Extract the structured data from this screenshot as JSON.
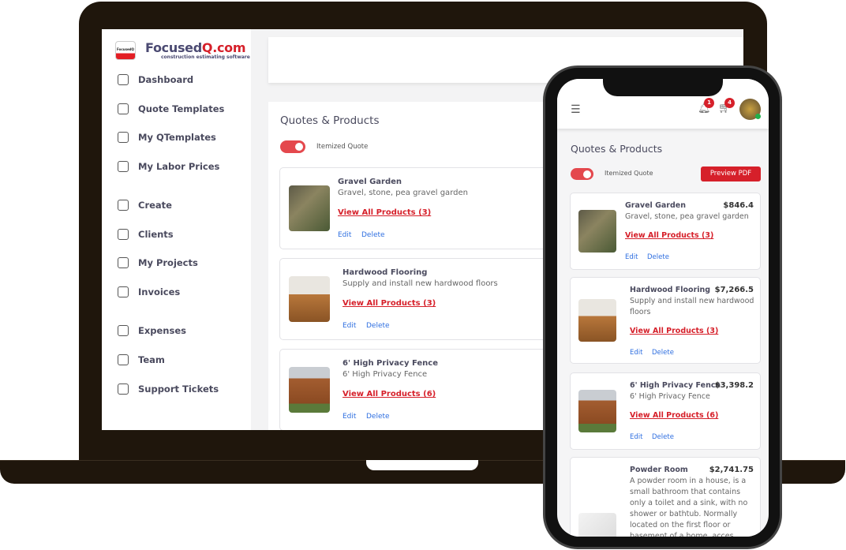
{
  "brand": {
    "name_main": "Focused",
    "name_accent": "Q.com",
    "tagline": "construction estimating software",
    "logo_text": "FocusedQ"
  },
  "sidebar": {
    "items": [
      {
        "label": "Dashboard",
        "icon": "home-icon"
      },
      {
        "label": "Quote Templates",
        "icon": "shopping-bag-icon"
      },
      {
        "label": "My QTemplates",
        "icon": "download-icon"
      },
      {
        "label": "My Labor Prices",
        "icon": "box-icon"
      },
      {
        "label": "Create",
        "icon": "plus-circle-icon"
      },
      {
        "label": "Clients",
        "icon": "users-icon"
      },
      {
        "label": "My Projects",
        "icon": "cart-icon"
      },
      {
        "label": "Invoices",
        "icon": "book-icon"
      },
      {
        "label": "Expenses",
        "icon": "dollar-icon"
      },
      {
        "label": "Team",
        "icon": "team-icon"
      },
      {
        "label": "Support Tickets",
        "icon": "alert-circle-icon"
      }
    ]
  },
  "main": {
    "title": "Quotes & Products",
    "toggle_label": "Itemized Quote",
    "toggle_on": true,
    "preview_label": "Preview PDF",
    "edit": "Edit",
    "delete": "Delete"
  },
  "header": {
    "notifications": "1",
    "cart": "4"
  },
  "products": [
    {
      "name": "Gravel Garden",
      "desc": "Gravel, stone, pea gravel garden",
      "link": "View All Products (3)",
      "price": "$846.4"
    },
    {
      "name": "Hardwood Flooring",
      "desc": "Supply and install new hardwood floors",
      "link": "View All Products (3)",
      "price": "$7,266.5"
    },
    {
      "name": "6' High Privacy Fence",
      "desc": "6' High Privacy Fence",
      "link": "View All Products (6)",
      "price": "$3,398.2"
    },
    {
      "name": "Powder Room",
      "desc": "A powder room in a house, is a small bathroom that contains only a toilet and a sink, with no shower or bathtub. Normally located on the first floor or basement of a home, acces",
      "price": "$2,741.75"
    }
  ],
  "colors": {
    "accent": "#d6202a",
    "toggle": "#e4484d",
    "link": "#2f6fe0",
    "device": "#1f160c"
  }
}
